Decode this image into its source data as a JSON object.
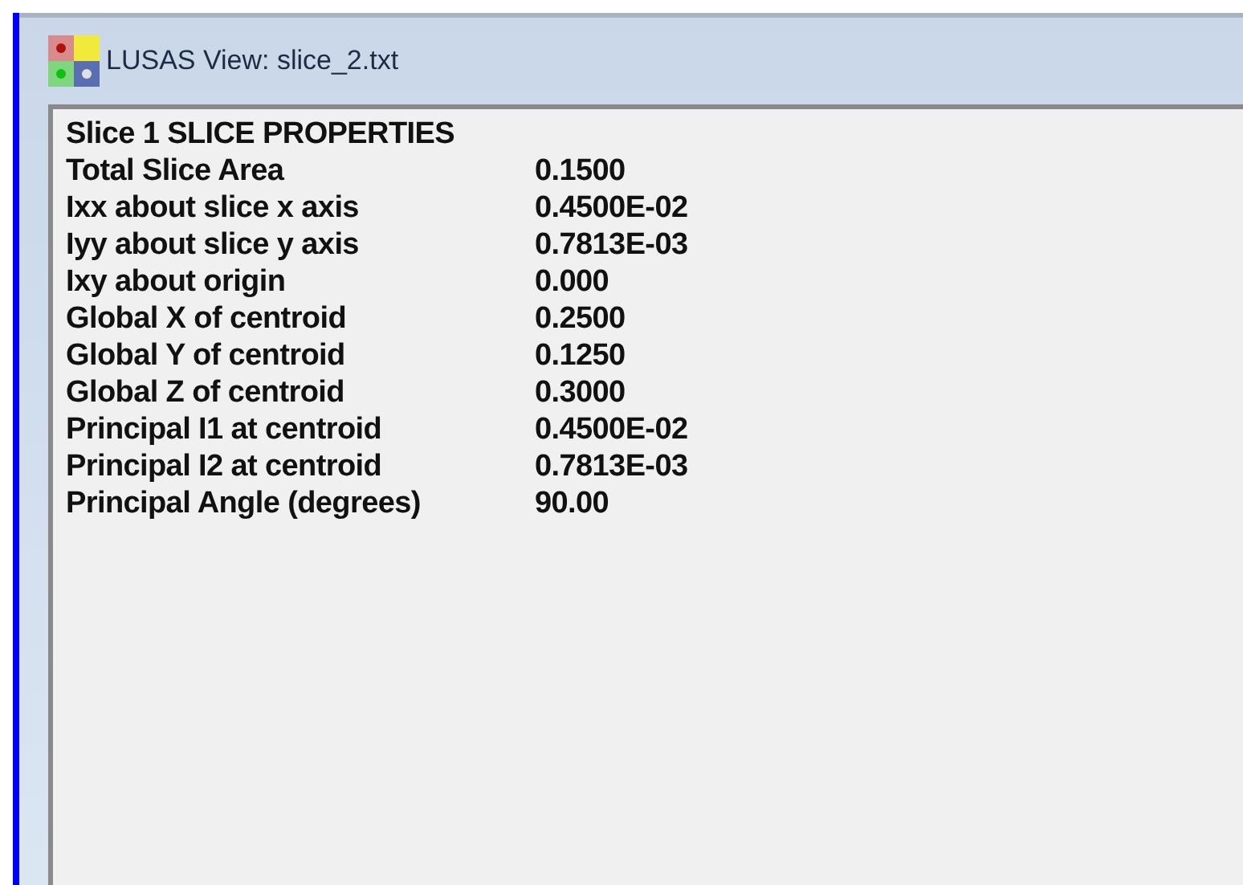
{
  "window": {
    "title": "LUSAS View: slice_2.txt"
  },
  "heading": "Slice 1 SLICE PROPERTIES",
  "rows": [
    {
      "label": "Total Slice Area",
      "value": "0.1500"
    },
    {
      "label": "Ixx about slice x axis",
      "value": "0.4500E-02"
    },
    {
      "label": "Iyy about slice y axis",
      "value": "0.7813E-03"
    },
    {
      "label": "Ixy about origin",
      "value": "0.000"
    },
    {
      "label": "Global X of centroid",
      "value": "0.2500"
    },
    {
      "label": "Global Y of centroid",
      "value": "0.1250"
    },
    {
      "label": "Global Z of centroid",
      "value": "0.3000"
    },
    {
      "label": "Principal I1 at centroid",
      "value": "0.4500E-02"
    },
    {
      "label": "Principal I2 at centroid",
      "value": "0.7813E-03"
    },
    {
      "label": "Principal Angle (degrees)",
      "value": "90.00"
    }
  ]
}
